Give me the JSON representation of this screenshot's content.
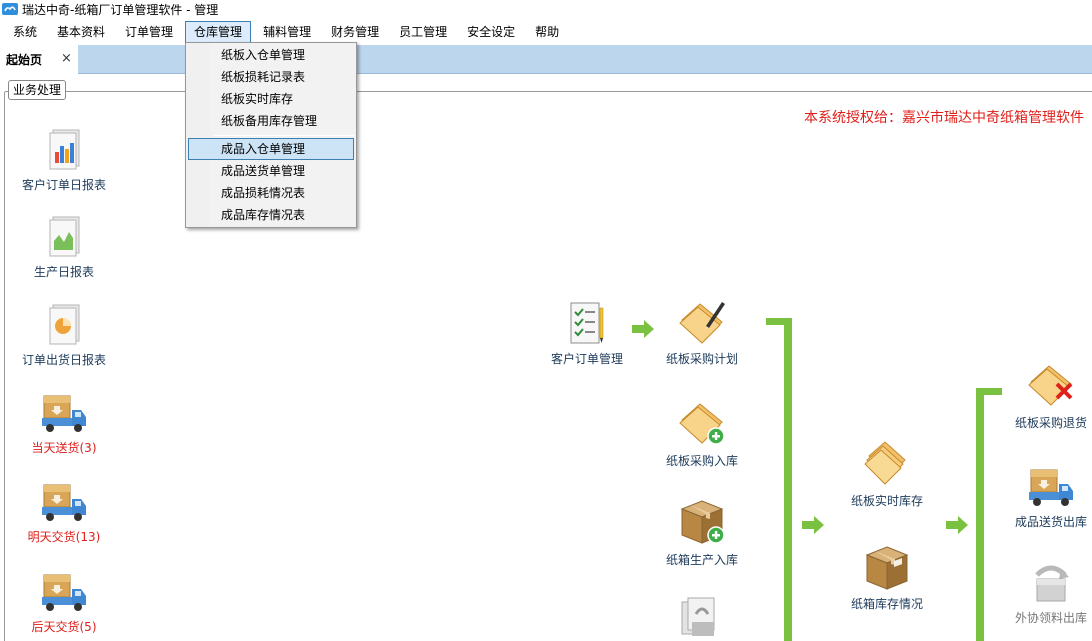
{
  "window": {
    "title": "瑞达中奇-纸箱厂订单管理软件 - 管理"
  },
  "menubar": {
    "items": [
      {
        "label": "系统"
      },
      {
        "label": "基本资料"
      },
      {
        "label": "订单管理"
      },
      {
        "label": "仓库管理"
      },
      {
        "label": "辅料管理"
      },
      {
        "label": "财务管理"
      },
      {
        "label": "员工管理"
      },
      {
        "label": "安全设定"
      },
      {
        "label": "帮助"
      }
    ]
  },
  "tabs": [
    {
      "label": "起始页",
      "close": "×"
    }
  ],
  "group": {
    "label": "业务处理"
  },
  "license": "本系统授权给：嘉兴市瑞达中奇纸箱管理软件",
  "dropdown": {
    "items": [
      {
        "label": "纸板入仓单管理"
      },
      {
        "label": "纸板损耗记录表"
      },
      {
        "label": "纸板实时库存"
      },
      {
        "label": "纸板备用库存管理"
      },
      {
        "label": "成品入仓单管理"
      },
      {
        "label": "成品送货单管理"
      },
      {
        "label": "成品损耗情况表"
      },
      {
        "label": "成品库存情况表"
      }
    ],
    "selected_index": 4
  },
  "left_tiles": [
    {
      "label": "客户订单日报表",
      "icon": "report-chart-icon"
    },
    {
      "label": "生产日报表",
      "icon": "report-area-icon"
    },
    {
      "label": "订单出货日报表",
      "icon": "report-pie-icon"
    },
    {
      "label": "当天送货(3)",
      "icon": "delivery-truck-icon"
    },
    {
      "label": "明天交货(13)",
      "icon": "delivery-truck-icon"
    },
    {
      "label": "后天交货(5)",
      "icon": "delivery-truck-icon"
    }
  ],
  "flow_tiles": {
    "order": {
      "label": "客户订单管理",
      "icon": "checklist-icon"
    },
    "purchase_plan": {
      "label": "纸板采购计划",
      "icon": "paper-pen-icon"
    },
    "purchase_in": {
      "label": "纸板采购入库",
      "icon": "paper-add-icon"
    },
    "box_in": {
      "label": "纸箱生产入库",
      "icon": "box-add-icon"
    },
    "realtime_stock": {
      "label": "纸板实时库存",
      "icon": "paper-stack-icon"
    },
    "box_stock": {
      "label": "纸箱库存情况",
      "icon": "box-icon"
    },
    "purchase_return": {
      "label": "纸板采购退货",
      "icon": "paper-cancel-icon"
    },
    "product_out": {
      "label": "成品送货出库",
      "icon": "delivery-truck-icon"
    },
    "outsource_out": {
      "label": "外协领料出库",
      "icon": "outsource-icon"
    }
  }
}
